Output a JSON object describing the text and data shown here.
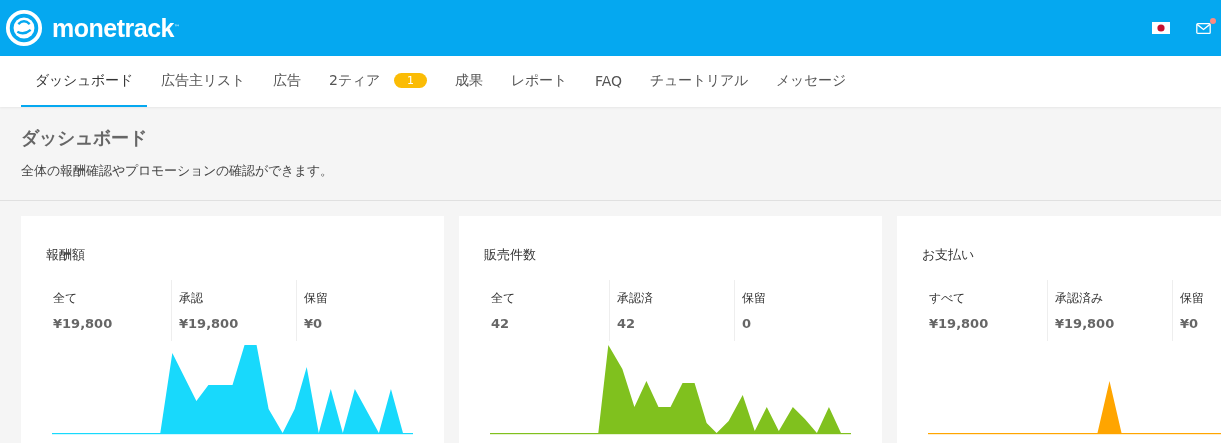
{
  "header": {
    "brand": "monetrack",
    "trademark": "™",
    "mail_unread": true
  },
  "nav": [
    {
      "label": "ダッシュボード",
      "selected": true
    },
    {
      "label": "広告主リスト",
      "selected": false
    },
    {
      "label": "広告",
      "selected": false
    },
    {
      "label": "2ティア",
      "selected": false,
      "badge": "1"
    },
    {
      "label": "成果",
      "selected": false
    },
    {
      "label": "レポート",
      "selected": false
    },
    {
      "label": "FAQ",
      "selected": false
    },
    {
      "label": "チュートリアル",
      "selected": false
    },
    {
      "label": "メッセージ",
      "selected": false
    }
  ],
  "page": {
    "title": "ダッシュボード",
    "description": "全体の報酬確認やプロモーションの確認ができます。"
  },
  "cards": [
    {
      "title": "報酬額",
      "color": "#18d9fc",
      "stats": [
        {
          "label": "全て",
          "value": "¥19,800"
        },
        {
          "label": "承認",
          "value": "¥19,800"
        },
        {
          "label": "保留",
          "value": "¥0"
        }
      ]
    },
    {
      "title": "販売件数",
      "color": "#80c11e",
      "stats": [
        {
          "label": "全て",
          "value": "42"
        },
        {
          "label": "承認済",
          "value": "42"
        },
        {
          "label": "保留",
          "value": "0"
        }
      ]
    },
    {
      "title": "お支払い",
      "color": "#ffa500",
      "stats": [
        {
          "label": "すべて",
          "value": "¥19,800"
        },
        {
          "label": "承認済み",
          "value": "¥19,800"
        },
        {
          "label": "保留",
          "value": "¥0"
        }
      ]
    }
  ]
}
